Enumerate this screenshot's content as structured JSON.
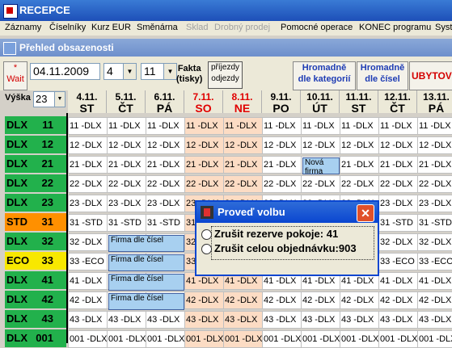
{
  "app": {
    "title": "RECEPCE"
  },
  "menu": [
    {
      "label": "Záznamy",
      "disabled": false
    },
    {
      "label": "Číselníky",
      "disabled": false
    },
    {
      "label": "Kurz EUR",
      "disabled": false
    },
    {
      "label": "Směnárna",
      "disabled": false
    },
    {
      "label": "Sklad",
      "disabled": true
    },
    {
      "label": "Drobný prodej",
      "disabled": true
    },
    {
      "label": "Pomocné operace",
      "disabled": false
    },
    {
      "label": "KONEC programu",
      "disabled": false
    },
    {
      "label": "Syst",
      "disabled": false
    }
  ],
  "window": {
    "title": "Přehled obsazenosti"
  },
  "toolbar": {
    "wait_star": "*",
    "wait_label": "Wait",
    "date": "04.11.2009",
    "combo1": "4",
    "combo2": "11",
    "fakta_line1": "Fakta",
    "fakta_line2": "(tisky)",
    "prijezdy_line1": "příjezdy",
    "prijezdy_line2": "odjezdy",
    "hrom_kat_line1": "Hromadně",
    "hrom_kat_line2": "dle kategorií",
    "hrom_cis_line1": "Hromadně",
    "hrom_cis_line2": "dle čísel",
    "ubytov": "UBYTOV"
  },
  "height": {
    "label": "Výška",
    "value": "23"
  },
  "days": [
    {
      "date": "4.11.",
      "dow": "ST",
      "weekend": false
    },
    {
      "date": "5.11.",
      "dow": "ČT",
      "weekend": false
    },
    {
      "date": "6.11.",
      "dow": "PÁ",
      "weekend": false
    },
    {
      "date": "7.11.",
      "dow": "SO",
      "weekend": true
    },
    {
      "date": "8.11.",
      "dow": "NE",
      "weekend": true
    },
    {
      "date": "9.11.",
      "dow": "PO",
      "weekend": false
    },
    {
      "date": "10.11.",
      "dow": "ÚT",
      "weekend": false
    },
    {
      "date": "11.11.",
      "dow": "ST",
      "weekend": false
    },
    {
      "date": "12.11.",
      "dow": "ČT",
      "weekend": false
    },
    {
      "date": "13.11.",
      "dow": "PÁ",
      "weekend": false
    }
  ],
  "rooms": [
    {
      "type": "DLX",
      "num": "11",
      "color": "#22b14c",
      "cell": "11 -DLX"
    },
    {
      "type": "DLX",
      "num": "12",
      "color": "#22b14c",
      "cell": "12 -DLX"
    },
    {
      "type": "DLX",
      "num": "21",
      "color": "#22b14c",
      "cell": "21 -DLX"
    },
    {
      "type": "DLX",
      "num": "22",
      "color": "#22b14c",
      "cell": "22 -DLX"
    },
    {
      "type": "DLX",
      "num": "23",
      "color": "#22b14c",
      "cell": "23 -DLX"
    },
    {
      "type": "STD",
      "num": "31",
      "color": "#ff9000",
      "cell": "31 -STD"
    },
    {
      "type": "DLX",
      "num": "32",
      "color": "#22b14c",
      "cell": "32 -DLX"
    },
    {
      "type": "ECO",
      "num": "33",
      "color": "#f8e800",
      "cell": "33 -ECO"
    },
    {
      "type": "DLX",
      "num": "41",
      "color": "#22b14c",
      "cell": "41 -DLX"
    },
    {
      "type": "DLX",
      "num": "42",
      "color": "#22b14c",
      "cell": "42 -DLX"
    },
    {
      "type": "DLX",
      "num": "43",
      "color": "#22b14c",
      "cell": "43 -DLX"
    },
    {
      "type": "DLX",
      "num": "001",
      "color": "#22b14c",
      "cell": "001 -DLX"
    }
  ],
  "reservations": [
    {
      "label": "Nová firma",
      "row": 2,
      "col": 6,
      "span": 1
    },
    {
      "label": "Firma dle čísel",
      "row": 6,
      "col": 1,
      "span": 2
    },
    {
      "label": "Firma dle čísel",
      "row": 7,
      "col": 1,
      "span": 2
    },
    {
      "label": "Firma dle čísel",
      "row": 8,
      "col": 1,
      "span": 2
    },
    {
      "label": "Firma dle čísel",
      "row": 9,
      "col": 1,
      "span": 2
    }
  ],
  "dialog": {
    "title": "Proveď volbu",
    "close": "✕",
    "opt1": "Zrušit rezerve pokoje:  41",
    "opt2": "Zrušit celou objednávku:903"
  }
}
